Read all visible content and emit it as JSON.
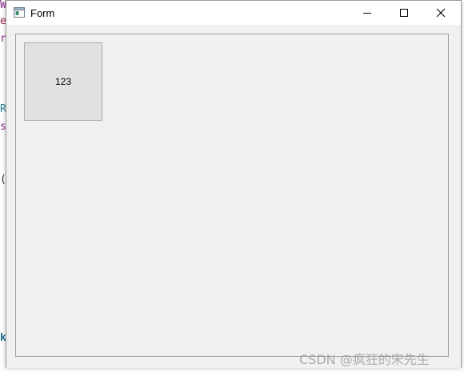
{
  "background_fragments": [
    {
      "text": "W",
      "color": "#8b2f8b"
    },
    {
      "text": "e",
      "color": "#a0285a"
    },
    {
      "text": "r",
      "color": "#8b2f8b"
    },
    {
      "text": "R",
      "color": "#2a7f9a"
    },
    {
      "text": "s",
      "color": "#8b2f8b"
    },
    {
      "text": "(",
      "color": "#333333"
    },
    {
      "text": "k",
      "color": "#1f6f8b"
    }
  ],
  "window": {
    "title": "Form",
    "controls": {
      "minimize_icon": "minimize-icon",
      "maximize_icon": "maximize-icon",
      "close_icon": "close-icon"
    }
  },
  "client": {
    "button_label": "123"
  },
  "watermark": "CSDN @疯狂的宋先生",
  "colors": {
    "window_bg": "#f0f0f0",
    "titlebar_bg": "#ffffff",
    "button_bg": "#e1e1e1",
    "button_border": "#adadad"
  }
}
